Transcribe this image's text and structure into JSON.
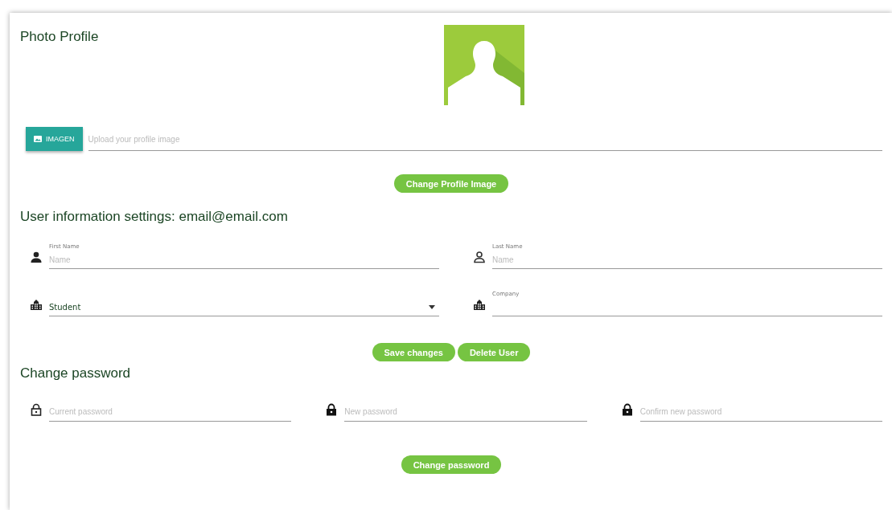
{
  "photo_section": {
    "title": "Photo Profile",
    "kind": "picture",
    "upload_button": "IMAGEN",
    "upload_field": {
      "placeholder": "Upload your profile image"
    },
    "change_button": "Change Profile Image"
  },
  "user_section": {
    "title": "User information settings: email@email.com",
    "rows": [
      {
        "fields": [
          {
            "kind": "text",
            "label": "First Name",
            "placeholder": "Name"
          },
          {
            "kind": "text",
            "label": "Last Name",
            "placeholder": "Name"
          }
        ]
      },
      {
        "fields": [
          {
            "kind": "select",
            "value": "Student"
          },
          {
            "kind": "text",
            "label": "Company"
          }
        ]
      }
    ],
    "buttons": [
      "Save changes",
      "Delete User"
    ]
  },
  "password_section": {
    "title": "Change password",
    "fields": [
      {
        "placeholder": "Current password"
      },
      {
        "placeholder": "New password"
      },
      {
        "placeholder": "Confirm new password"
      }
    ],
    "button": "Change password"
  }
}
